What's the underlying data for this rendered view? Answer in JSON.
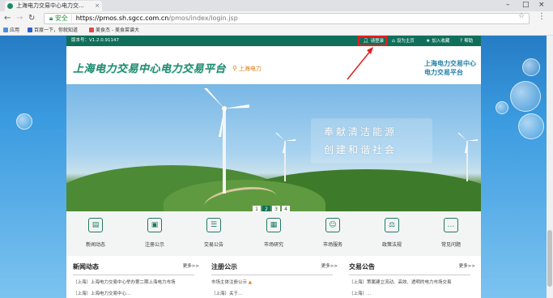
{
  "browser": {
    "tab_title": "上海电力交易中心电力交...",
    "url_secure_label": "安全",
    "url_host": "https://pmos.sh.sgcc.com.cn",
    "url_path": "/pmos/index/login.jsp",
    "bookmarks": [
      "应用",
      "百度一下，你就知道",
      "美食杰 - 美食菜谱大"
    ]
  },
  "topbar": {
    "version": "版本号：V1.2.0.91147",
    "login": "请登录",
    "set_home": "设为主页",
    "add_fav": "加入收藏",
    "help": "帮助"
  },
  "header": {
    "logo": "上海电力交易中心电力交易平台",
    "region": "上海电力",
    "right_line1": "上海电力交易中心",
    "right_line2": "电力交易平台"
  },
  "banner": {
    "slogan_line1": "奉献清洁能源",
    "slogan_line2": "创建和谐社会",
    "pages": [
      "1",
      "2",
      "3",
      "4"
    ],
    "active_page": "2"
  },
  "quick_links": [
    {
      "label": "新闻动态",
      "icon": "news-icon",
      "glyph": "▤"
    },
    {
      "label": "注册公示",
      "icon": "register-icon",
      "glyph": "▣"
    },
    {
      "label": "交易公告",
      "icon": "notice-icon",
      "glyph": "☰"
    },
    {
      "label": "市场研究",
      "icon": "research-icon",
      "glyph": "▦"
    },
    {
      "label": "市场服务",
      "icon": "service-icon",
      "glyph": "☺"
    },
    {
      "label": "政策法规",
      "icon": "policy-icon",
      "glyph": "⚖"
    },
    {
      "label": "常见问题",
      "icon": "faq-icon",
      "glyph": "…"
    }
  ],
  "news_sections": [
    {
      "title": "新闻动态",
      "more": "更多>>",
      "items": [
        "（上海）上海电力交易中心举办第二期上海电力市场",
        "（上海）上海电力交易中心..."
      ]
    },
    {
      "title": "注册公示",
      "more": "更多>>",
      "items": [
        "市场主体注册公示",
        "（上海）关于..."
      ]
    },
    {
      "title": "交易公告",
      "more": "更多>>",
      "items": [
        "（上海）策属建立流动、高效、透明的电力市场交易",
        "（上海）..."
      ]
    }
  ],
  "colors": {
    "brand_green": "#106f5a",
    "highlight_red": "#e02020",
    "region_orange": "#e27a10"
  }
}
